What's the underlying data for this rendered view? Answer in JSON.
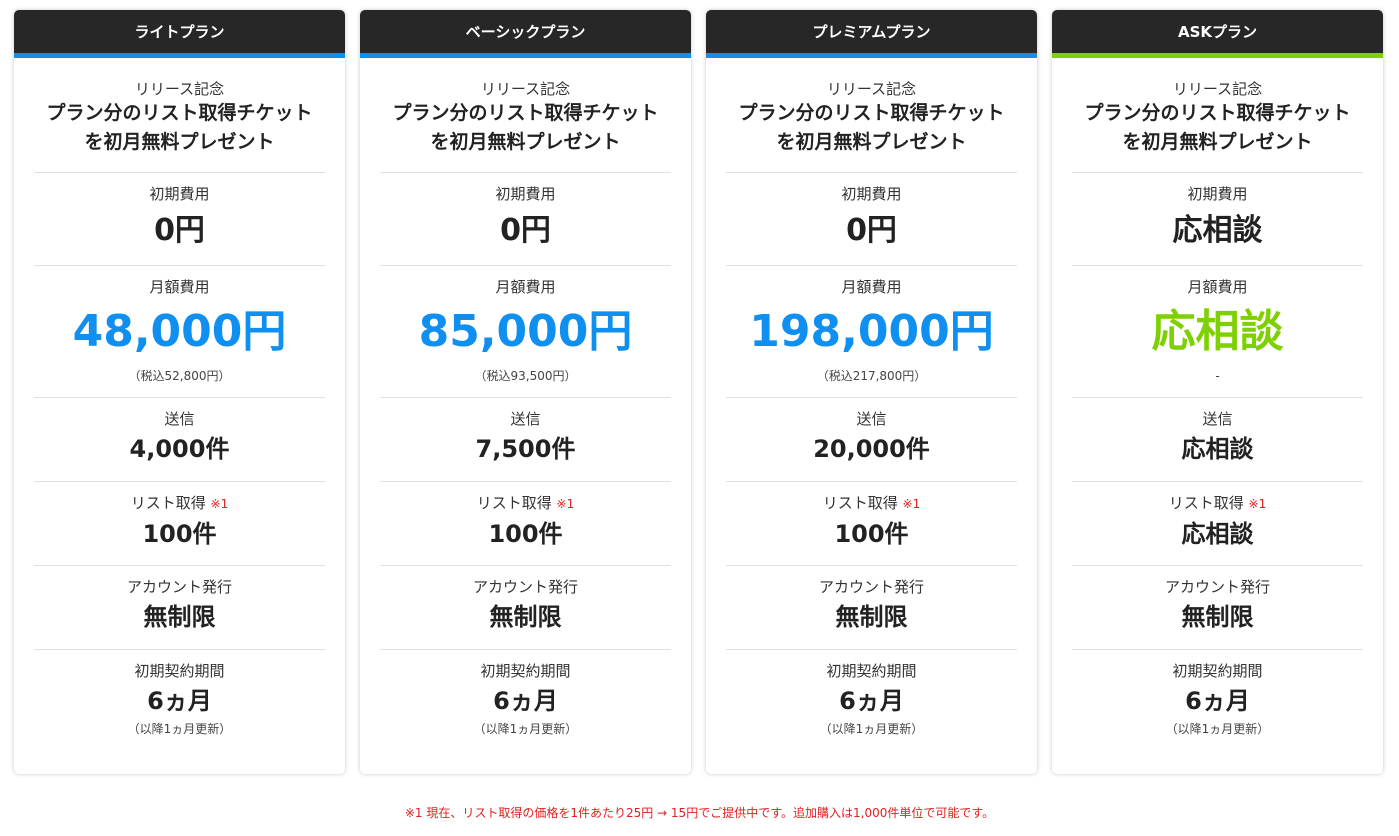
{
  "plans": [
    {
      "name": "ライトプラン",
      "promo": [
        "リリース記念",
        "プラン分のリスト取得チケット",
        "を初月無料プレゼント"
      ],
      "initial_label": "初期費用",
      "initial_value": "0円",
      "monthly_label": "月額費用",
      "monthly_value": "48,000円",
      "monthly_tax": "（税込52,800円）",
      "send_label": "送信",
      "send_value": "4,000件",
      "list_label": "リスト取得",
      "list_note": "※1",
      "list_value": "100件",
      "account_label": "アカウント発行",
      "account_value": "無制限",
      "term_label": "初期契約期間",
      "term_value": "6ヵ月",
      "term_renew": "（以降1ヵ月更新）"
    },
    {
      "name": "ベーシックプラン",
      "promo": [
        "リリース記念",
        "プラン分のリスト取得チケット",
        "を初月無料プレゼント"
      ],
      "initial_label": "初期費用",
      "initial_value": "0円",
      "monthly_label": "月額費用",
      "monthly_value": "85,000円",
      "monthly_tax": "（税込93,500円）",
      "send_label": "送信",
      "send_value": "7,500件",
      "list_label": "リスト取得",
      "list_note": "※1",
      "list_value": "100件",
      "account_label": "アカウント発行",
      "account_value": "無制限",
      "term_label": "初期契約期間",
      "term_value": "6ヵ月",
      "term_renew": "（以降1ヵ月更新）"
    },
    {
      "name": "プレミアムプラン",
      "promo": [
        "リリース記念",
        "プラン分のリスト取得チケット",
        "を初月無料プレゼント"
      ],
      "initial_label": "初期費用",
      "initial_value": "0円",
      "monthly_label": "月額費用",
      "monthly_value": "198,000円",
      "monthly_tax": "（税込217,800円）",
      "send_label": "送信",
      "send_value": "20,000件",
      "list_label": "リスト取得",
      "list_note": "※1",
      "list_value": "100件",
      "account_label": "アカウント発行",
      "account_value": "無制限",
      "term_label": "初期契約期間",
      "term_value": "6ヵ月",
      "term_renew": "（以降1ヵ月更新）"
    },
    {
      "name": "ASKプラン",
      "promo": [
        "リリース記念",
        "プラン分のリスト取得チケット",
        "を初月無料プレゼント"
      ],
      "initial_label": "初期費用",
      "initial_value": "応相談",
      "monthly_label": "月額費用",
      "monthly_value": "応相談",
      "monthly_tax": "-",
      "send_label": "送信",
      "send_value": "応相談",
      "list_label": "リスト取得",
      "list_note": "※1",
      "list_value": "応相談",
      "account_label": "アカウント発行",
      "account_value": "無制限",
      "term_label": "初期契約期間",
      "term_value": "6ヵ月",
      "term_renew": "（以降1ヵ月更新）"
    }
  ],
  "footnote": "※1 現在、リスト取得の価格を1件あたり25円 → 15円でご提供中です。追加購入は1,000件単位で可能です。",
  "colors": {
    "header_bg": "#272727",
    "accent_blue": "#0f8ff0",
    "accent_green": "#7ed000",
    "note_red": "#e02020"
  }
}
